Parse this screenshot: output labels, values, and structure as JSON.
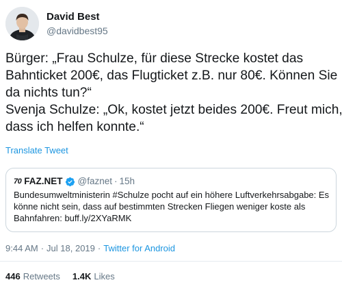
{
  "author": {
    "name": "David Best",
    "handle": "@davidbest95"
  },
  "tweet": {
    "lines": [
      "Bürger: „Frau Schulze, für diese Strecke kostet das",
      "Bahnticket 200€, das Flugticket z.B. nur 80€. Können Sie",
      "da nichts tun?“",
      "Svenja Schulze: „Ok, kostet jetzt beides 200€. Freut mich,",
      "dass ich helfen konnte.“"
    ],
    "translate_label": "Translate Tweet"
  },
  "quoted_tweet": {
    "logo_text": "70",
    "name": "FAZ.NET",
    "handle": "@faznet",
    "separator": "·",
    "time": "15h",
    "lines": [
      "Bundesumweltministerin #Schulze pocht auf ein höhere Luftverkehrsabgabe: Es",
      "könne nicht sein, dass auf bestimmten Strecken Fliegen weniger koste als"
    ],
    "last_line_prefix": "Bahnfahren: ",
    "link": "buff.ly/2XYaRMK"
  },
  "meta": {
    "time": "9:44 AM",
    "separator": "·",
    "date": "Jul 18, 2019",
    "via": "Twitter for Android"
  },
  "stats": {
    "retweets_count": "446",
    "retweets_label": "Retweets",
    "likes_count": "1.4K",
    "likes_label": "Likes"
  },
  "colors": {
    "link_blue": "#1b95e0",
    "secondary_text": "#657786",
    "border": "#ccd6dd",
    "verified_blue": "#1da1f2"
  },
  "icons": {
    "verified": "verified-badge-icon",
    "avatar": "avatar"
  }
}
